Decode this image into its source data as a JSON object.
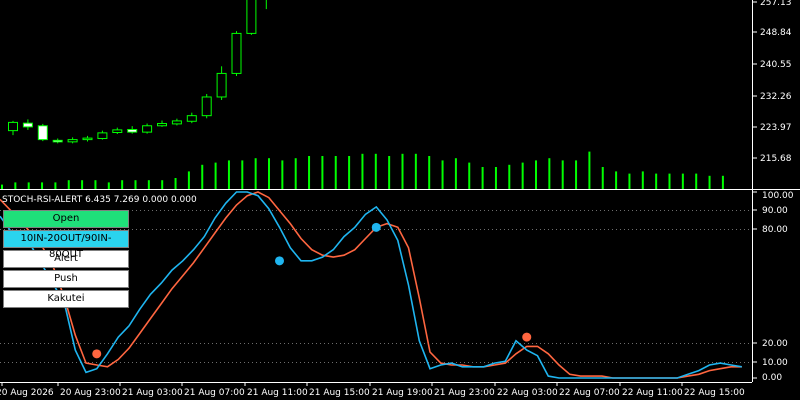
{
  "price_chart": {
    "price_labels": [
      "257.13",
      "248.84",
      "240.55",
      "232.26",
      "223.97",
      "215.68"
    ],
    "candles": [
      {
        "o": 223.0,
        "c": 225.2,
        "h": 225.6,
        "l": 221.8
      },
      {
        "o": 225.0,
        "c": 224.0,
        "h": 226.0,
        "l": 223.2
      },
      {
        "o": 224.3,
        "c": 220.6,
        "h": 224.8,
        "l": 220.2
      },
      {
        "o": 220.4,
        "c": 220.0,
        "h": 220.9,
        "l": 219.6
      },
      {
        "o": 220.0,
        "c": 220.6,
        "h": 221.2,
        "l": 219.6
      },
      {
        "o": 220.6,
        "c": 221.0,
        "h": 221.6,
        "l": 220.1
      },
      {
        "o": 220.9,
        "c": 222.4,
        "h": 223.0,
        "l": 220.6
      },
      {
        "o": 222.5,
        "c": 223.2,
        "h": 223.8,
        "l": 222.1
      },
      {
        "o": 223.3,
        "c": 222.6,
        "h": 224.2,
        "l": 222.2
      },
      {
        "o": 222.6,
        "c": 224.3,
        "h": 224.9,
        "l": 222.2
      },
      {
        "o": 224.3,
        "c": 224.9,
        "h": 225.7,
        "l": 224.0
      },
      {
        "o": 224.8,
        "c": 225.6,
        "h": 226.2,
        "l": 224.4
      },
      {
        "o": 225.5,
        "c": 227.0,
        "h": 227.8,
        "l": 225.0
      },
      {
        "o": 227.0,
        "c": 232.0,
        "h": 232.8,
        "l": 226.3
      },
      {
        "o": 232.0,
        "c": 238.3,
        "h": 240.2,
        "l": 231.2
      },
      {
        "o": 238.3,
        "c": 249.0,
        "h": 249.6,
        "l": 237.6
      },
      {
        "o": 249.0,
        "c": 258.5,
        "h": 259.5,
        "l": 248.6
      },
      {
        "o": 258.5,
        "c": 259.5,
        "h": 259.9,
        "l": 255.5
      }
    ],
    "volumes": [
      2,
      3,
      3,
      3,
      3,
      4,
      4,
      4,
      3,
      4,
      4,
      4,
      4,
      5,
      8,
      11,
      12,
      13,
      13,
      14,
      14,
      13,
      14,
      15,
      15,
      15,
      15,
      16,
      16,
      15,
      16,
      16,
      15,
      13,
      14,
      12,
      10,
      10,
      11,
      12,
      13,
      14,
      13,
      13,
      17,
      10,
      8,
      7,
      8,
      7,
      7,
      7,
      7,
      6,
      6
    ]
  },
  "indicator": {
    "header": "STOCH-RSI-ALERT 6.435 7.269 0.000 0.000",
    "level_labels": [
      "100.00",
      "90.00",
      "80.00",
      "20.00",
      "10.00",
      "0.00"
    ],
    "main_line_color": "#1fb5f0",
    "signal_line_color": "#ff6640",
    "main_line": [
      87,
      79,
      75,
      70,
      60,
      50,
      40,
      15,
      3,
      5,
      13,
      22,
      28,
      37,
      45,
      51,
      58,
      63,
      69,
      76,
      86,
      94,
      100,
      100,
      98,
      91,
      81,
      70,
      63,
      63,
      65,
      69,
      76,
      81,
      88,
      92,
      85,
      74,
      50,
      20,
      5,
      7,
      8,
      6,
      6,
      6,
      8,
      9,
      20,
      15,
      12,
      1,
      0,
      0,
      0,
      0,
      0,
      0,
      0,
      0,
      0,
      0,
      0,
      0,
      2,
      4,
      7,
      8,
      7,
      6
    ],
    "signal_line": [
      96,
      90,
      84,
      77,
      70,
      59,
      43,
      23,
      8,
      7,
      6,
      10,
      16,
      24,
      32,
      40,
      48,
      55,
      62,
      70,
      78,
      86,
      93,
      98,
      100,
      97,
      90,
      83,
      75,
      69,
      66,
      65,
      66,
      69,
      75,
      81,
      83,
      81,
      70,
      43,
      14,
      8,
      7,
      7,
      6,
      6,
      7,
      8,
      13,
      17,
      17,
      13,
      7,
      2,
      1,
      1,
      1,
      0,
      0,
      0,
      0,
      0,
      0,
      0,
      1,
      2,
      4,
      5,
      6,
      6
    ],
    "buy_markers": [
      {
        "index": 26,
        "value": 63,
        "color": "#1fb5f0"
      },
      {
        "index": 35,
        "value": 81,
        "color": "#1fb5f0"
      }
    ],
    "sell_markers": [
      {
        "index": 9,
        "value": 13,
        "color": "#ff6640"
      },
      {
        "index": 49,
        "value": 22,
        "color": "#ff6640"
      }
    ]
  },
  "time_axis": {
    "labels": [
      "20 Aug 2026",
      "20 Aug 23:00",
      "21 Aug 03:00",
      "21 Aug 07:00",
      "21 Aug 11:00",
      "21 Aug 15:00",
      "21 Aug 19:00",
      "21 Aug 23:00",
      "22 Aug 03:00",
      "22 Aug 07:00",
      "22 Aug 11:00",
      "22 Aug 15:00"
    ]
  },
  "control_panel": {
    "open_label": "Open",
    "mode_label": "10IN-20OUT/90IN-80OUT",
    "alert_label": "Alert",
    "push_label": "Push",
    "kakutei_label": "Kakutei",
    "open_color": "#1fe07a",
    "mode_color": "#2ad4ee"
  },
  "colors": {
    "background": "#000000",
    "bull_candle": "#00ff00",
    "volume_bar": "#00ff00",
    "text": "#ffffff"
  }
}
